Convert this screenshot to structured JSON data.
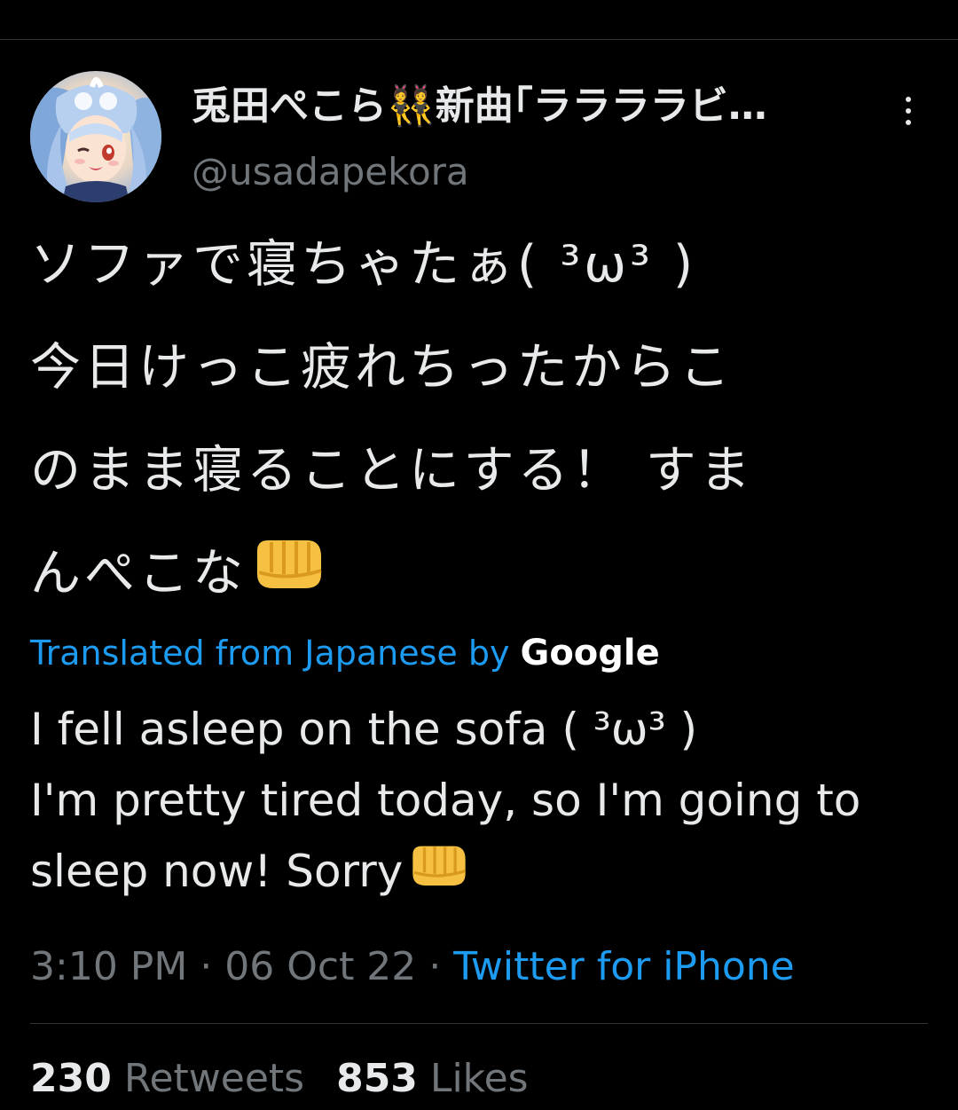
{
  "tweet": {
    "author": {
      "display_name": "兎田ぺこら👯新曲｢ララララビ…",
      "handle": "@usadapekora"
    },
    "text_lines": [
      "ソファで寝ちゃたぁ( ³ω³ )",
      "今日けっこ疲れちったからこ",
      "のまま寝ることにする！ すま",
      "んぺこな"
    ],
    "translation": {
      "label": "Translated from Japanese by",
      "provider": "Google",
      "lines": [
        "I fell asleep on the sofa ( ³ω³ )",
        "I'm pretty tired today, so I'm going to",
        "sleep now! Sorry"
      ]
    },
    "meta": {
      "time": "3:10 PM",
      "separator": " · ",
      "date": "06 Oct 22",
      "source": "Twitter for iPhone"
    },
    "stats": {
      "retweets_count": "230",
      "retweets_label": " Retweets",
      "likes_count": "853",
      "likes_label": " Likes"
    }
  },
  "icons": {
    "more": "more-vertical-icon",
    "fist": "oncoming-fist-icon",
    "avatar": "profile-avatar-image"
  },
  "colors": {
    "background": "#000000",
    "text": "#e7e9ea",
    "secondary_text": "#71767b",
    "link": "#1d9bf0",
    "divider": "#2f3336"
  }
}
